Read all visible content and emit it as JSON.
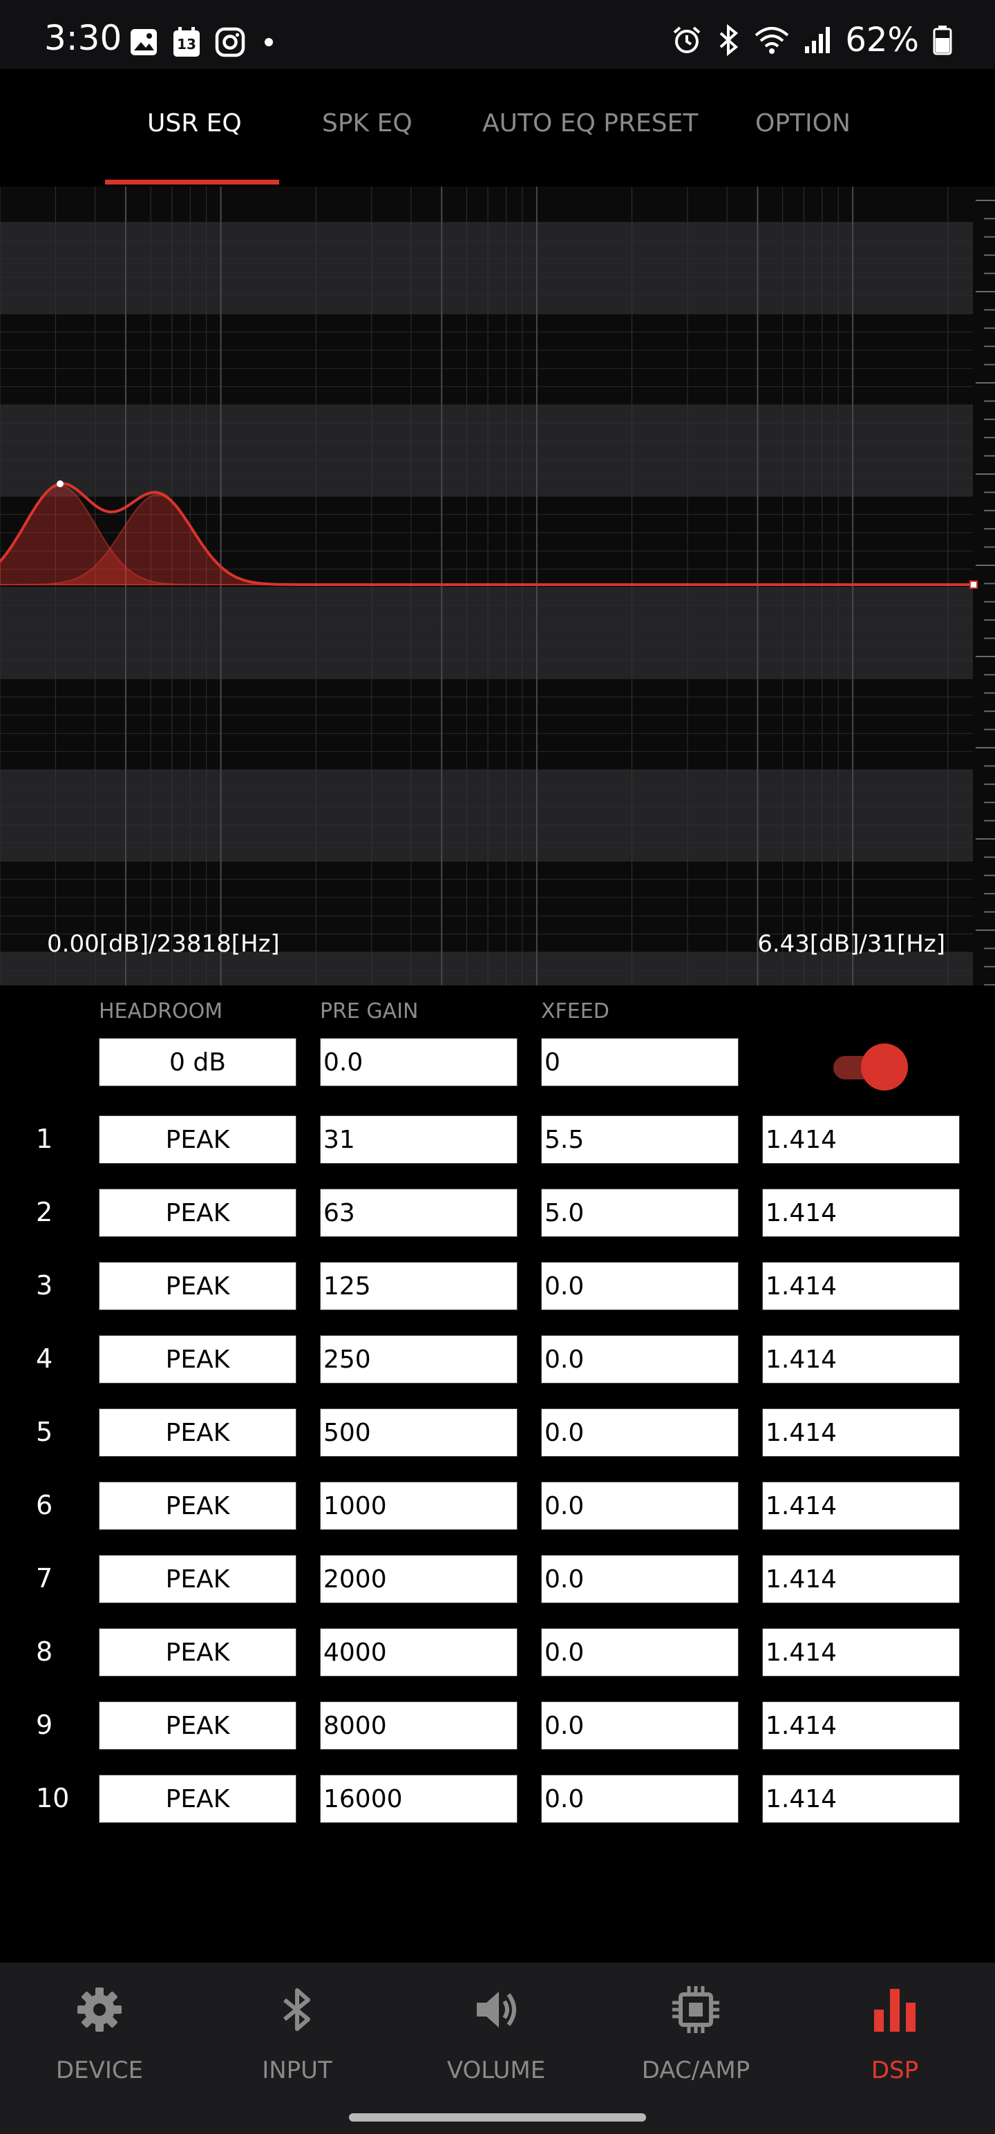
{
  "status_bar": {
    "time": "3:30",
    "calendar_day": "13",
    "battery": "62%"
  },
  "tabs": [
    {
      "label": "USR EQ",
      "active": true
    },
    {
      "label": "SPK EQ",
      "active": false
    },
    {
      "label": "AUTO EQ PRESET",
      "active": false
    },
    {
      "label": "OPTION",
      "active": false
    }
  ],
  "graph": {
    "left_readout": "0.00[dB]/23818[Hz]",
    "right_readout": "6.43[dB]/31[Hz]",
    "curve_color": "#d9342b"
  },
  "params": {
    "headroom_label": "HEADROOM",
    "pregain_label": "PRE GAIN",
    "xfeed_label": "XFEED",
    "headroom_value": "0 dB",
    "pregain_value": "0.0",
    "xfeed_value": "0",
    "enabled": true
  },
  "bands": [
    {
      "num": "1",
      "type": "PEAK",
      "freq": "31",
      "gain": "5.5",
      "q": "1.414"
    },
    {
      "num": "2",
      "type": "PEAK",
      "freq": "63",
      "gain": "5.0",
      "q": "1.414"
    },
    {
      "num": "3",
      "type": "PEAK",
      "freq": "125",
      "gain": "0.0",
      "q": "1.414"
    },
    {
      "num": "4",
      "type": "PEAK",
      "freq": "250",
      "gain": "0.0",
      "q": "1.414"
    },
    {
      "num": "5",
      "type": "PEAK",
      "freq": "500",
      "gain": "0.0",
      "q": "1.414"
    },
    {
      "num": "6",
      "type": "PEAK",
      "freq": "1000",
      "gain": "0.0",
      "q": "1.414"
    },
    {
      "num": "7",
      "type": "PEAK",
      "freq": "2000",
      "gain": "0.0",
      "q": "1.414"
    },
    {
      "num": "8",
      "type": "PEAK",
      "freq": "4000",
      "gain": "0.0",
      "q": "1.414"
    },
    {
      "num": "9",
      "type": "PEAK",
      "freq": "8000",
      "gain": "0.0",
      "q": "1.414"
    },
    {
      "num": "10",
      "type": "PEAK",
      "freq": "16000",
      "gain": "0.0",
      "q": "1.414"
    }
  ],
  "bottom_nav": [
    {
      "label": "DEVICE",
      "icon": "gear-icon",
      "active": false
    },
    {
      "label": "INPUT",
      "icon": "bluetooth-icon",
      "active": false
    },
    {
      "label": "VOLUME",
      "icon": "speaker-icon",
      "active": false
    },
    {
      "label": "DAC/AMP",
      "icon": "chip-icon",
      "active": false
    },
    {
      "label": "DSP",
      "icon": "bars-chart-icon",
      "active": true
    }
  ]
}
